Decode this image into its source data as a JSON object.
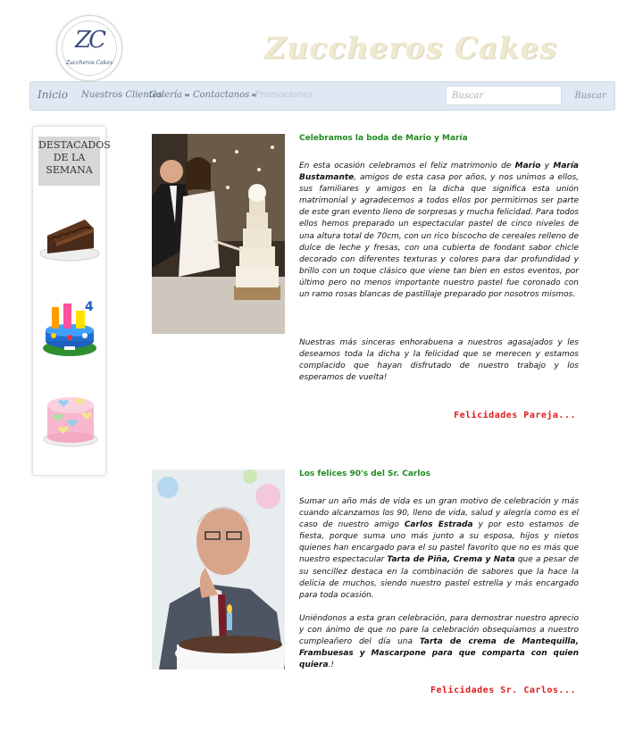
{
  "brand": {
    "logo_monogram": "ZC",
    "logo_text": "Zuccheros Cakes",
    "title": "Zuccheros Cakes"
  },
  "nav": {
    "home": "Inicio",
    "items": [
      {
        "label": "Nuestros Clientes",
        "dropdown": false,
        "disabled": false
      },
      {
        "label": "Galería",
        "dropdown": true,
        "disabled": false
      },
      {
        "label": "Contactanos",
        "dropdown": true,
        "disabled": false
      },
      {
        "label": "Promociones",
        "dropdown": false,
        "disabled": true
      }
    ],
    "search_placeholder": "Buscar",
    "search_button": "Buscar"
  },
  "sidebar": {
    "title_lines": [
      "DESTACADOS",
      "DE LA",
      "SEMANA"
    ],
    "items": [
      {
        "icon": "chocolate-cake-slice-icon"
      },
      {
        "icon": "toy-number-4-cake-icon"
      },
      {
        "icon": "pink-hearts-cake-icon"
      }
    ]
  },
  "posts": [
    {
      "title": "Celebramos la boda de Mario y María",
      "paragraph1": [
        {
          "t": "En esta ocasión celebramos el feliz matrimonio de ",
          "b": false
        },
        {
          "t": "Mario",
          "b": true
        },
        {
          "t": " y ",
          "b": false
        },
        {
          "t": "María Bustamante",
          "b": true
        },
        {
          "t": ", amigos de esta casa por años, y nos unimos a ellos, sus familiares y amigos en la dicha que significa esta unión matrimonial y agradecemos a todos ellos por permitirnos ser parte de este gran evento lleno de sorpresas y mucha felicidad. Para todos ellos hemos preparado un espectacular pastel de cinco niveles de una altura total de 70cm, con un rico biscocho de cereales relleno de dulce de leche y fresas, con una cubierta de fondant sabor chicle decorado con diferentes texturas y colores para dar profundidad y brillo con un toque clásico que viene tan bien en estos eventos, por último pero no menos importante nuestro pastel fue coronado con un ramo rosas blancas de pastillaje preparado por nosotros mismos.",
          "b": false
        }
      ],
      "paragraph2": [
        {
          "t": "Nuestras más sinceras enhorabuena a nuestros agasajados y les deseamos toda la dicha y la felicidad que se merecen y estamos complacido que hayan disfrutado de nuestro trabajo y los esperamos de vuelta!",
          "b": false
        }
      ],
      "signoff": "Felicidades Pareja...",
      "image": "wedding-couple-cutting-cake-photo"
    },
    {
      "title": "Los felices 90's del Sr. Carlos",
      "paragraph1": [
        {
          "t": "Sumar un año más de vida es un gran motivo de celebración y más cuando alcanzamos los 90, lleno de vida, salud y alegría como es el caso de nuestro amigo ",
          "b": false
        },
        {
          "t": "Carlos Estrada",
          "b": true
        },
        {
          "t": " y por esto estamos de fiesta, porque suma uno más junto a su esposa, hijos y nietos quienes han encargado para el su pastel favorito que no es más que nuestro espectacular ",
          "b": false
        },
        {
          "t": "Tarta de Piña, Crema y Nata",
          "b": true
        },
        {
          "t": " que a pesar de su sencillez destaca en la combinación de sabores que la hace la delicia de muchos, siendo nuestro pastel estrella y más encargado para toda ocasión.",
          "b": false
        }
      ],
      "paragraph2": [
        {
          "t": "Uniéndonos a esta gran celebración, para demostrar nuestro aprecio y con ánimo de que no pare la celebración obsequiamos a nuestro cumpleañero del día una ",
          "b": false
        },
        {
          "t": "Tarta de crema de Mantequilla, Frambuesas y Mascarpone para que comparta con quien quiera",
          "b": true
        },
        {
          "t": ".!",
          "b": false
        }
      ],
      "signoff": "Felicidades Sr. Carlos...",
      "image": "elderly-man-birthday-cake-photo"
    }
  ],
  "colors": {
    "post_title": "#1f8a1f",
    "signoff": "#e01a1a",
    "navbar_bg": "#dfe8f3",
    "brand_title": "#efe9cf"
  }
}
